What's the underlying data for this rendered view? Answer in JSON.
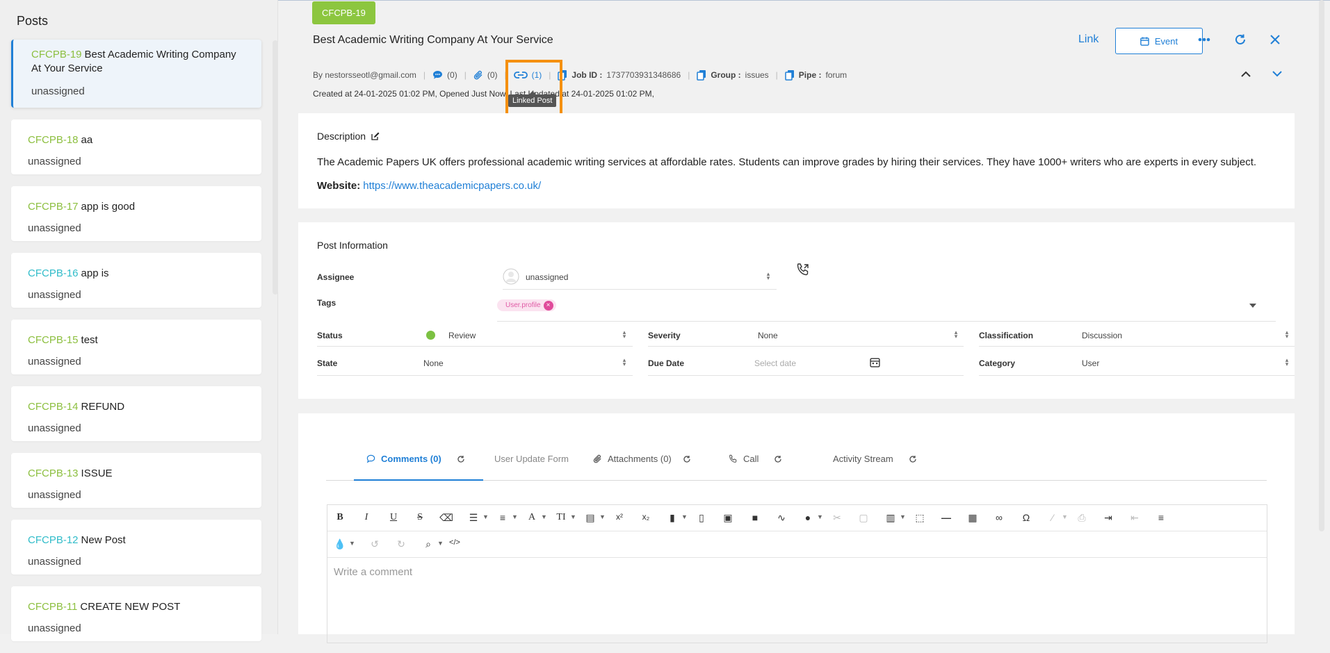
{
  "sidebar": {
    "title": "Posts",
    "posts": [
      {
        "key": "CFCPB-19",
        "title": "Best Academic Writing Company At Your Service",
        "assignee": "unassigned",
        "teal": false
      },
      {
        "key": "CFCPB-18",
        "title": "aa",
        "assignee": "unassigned",
        "teal": false
      },
      {
        "key": "CFCPB-17",
        "title": "app is good",
        "assignee": "unassigned",
        "teal": false
      },
      {
        "key": "CFCPB-16",
        "title": "app is",
        "assignee": "unassigned",
        "teal": true
      },
      {
        "key": "CFCPB-15",
        "title": "test",
        "assignee": "unassigned",
        "teal": false
      },
      {
        "key": "CFCPB-14",
        "title": "REFUND",
        "assignee": "unassigned",
        "teal": false
      },
      {
        "key": "CFCPB-13",
        "title": "ISSUE",
        "assignee": "unassigned",
        "teal": false
      },
      {
        "key": "CFCPB-12",
        "title": "New Post",
        "assignee": "unassigned",
        "teal": true
      },
      {
        "key": "CFCPB-11",
        "title": "CREATE NEW POST",
        "assignee": "unassigned",
        "teal": false
      }
    ]
  },
  "header": {
    "key": "CFCPB-19",
    "title": "Best Academic Writing Company At Your Service",
    "link_label": "Link",
    "event_label": "Event"
  },
  "meta": {
    "by": "By nestorsseotl@gmail.com",
    "comments": "(0)",
    "attachments": "(0)",
    "linked": "(1)",
    "job_id_label": "Job ID :",
    "job_id": "1737703931348686",
    "group_label": "Group :",
    "group": "issues",
    "pipe_label": "Pipe :",
    "pipe": "forum",
    "created": "Created at 24-01-2025 01:02 PM,   Opened Just Now,   Last Updated at 24-01-2025 01:02 PM,",
    "tooltip": "Linked Post"
  },
  "description": {
    "title": "Description",
    "text": "The Academic Papers UK offers professional academic writing services at affordable rates. Students can improve grades by hiring their services. They have 1000+ writers who are experts in every subject.",
    "website_label": "Website:",
    "website_url": "https://www.theacademicpapers.co.uk/"
  },
  "info": {
    "title": "Post Information",
    "assignee_label": "Assignee",
    "assignee": "unassigned",
    "tags_label": "Tags",
    "tag": "User.profile",
    "status_label": "Status",
    "status": "Review",
    "severity_label": "Severity",
    "severity": "None",
    "classification_label": "Classification",
    "classification": "Discussion",
    "state_label": "State",
    "state": "None",
    "due_label": "Due Date",
    "due_placeholder": "Select date",
    "category_label": "Category",
    "category": "User"
  },
  "tabs": {
    "comments": "Comments (0)",
    "user_update": "User Update Form",
    "attachments": "Attachments (0)",
    "call": "Call",
    "activity": "Activity Stream"
  },
  "editor": {
    "placeholder": "Write a comment",
    "superscript": "x²",
    "subscript": "x₂",
    "omega": "Ω",
    "code": "</>"
  },
  "colors": {
    "accent": "#1f7fd6",
    "badge_green": "#8cc63f",
    "highlight": "#f5900f"
  }
}
